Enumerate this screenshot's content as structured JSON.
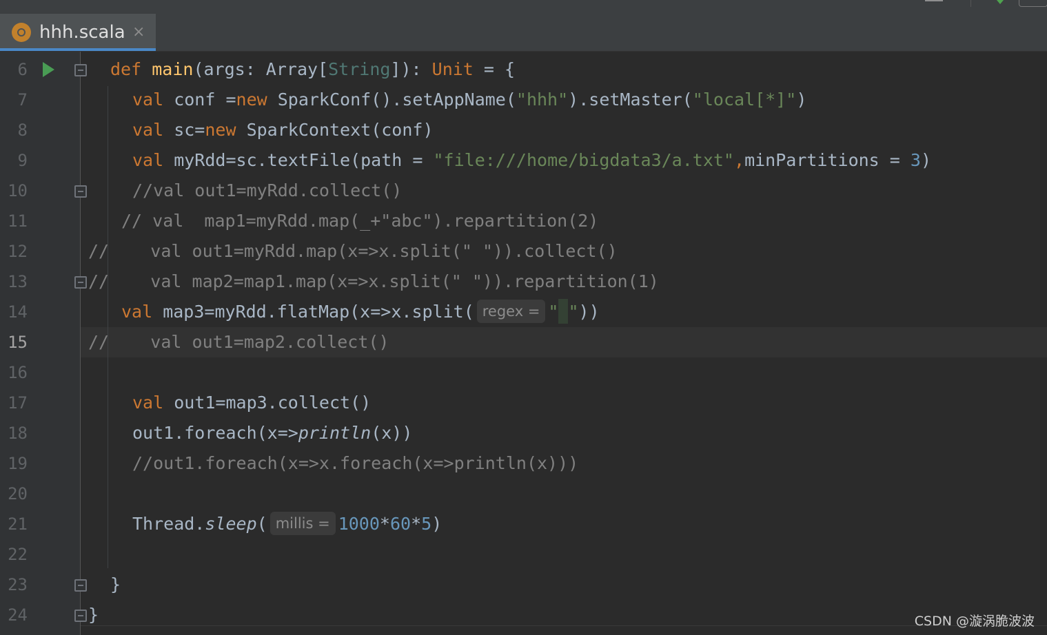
{
  "tab": {
    "label": "hhh.scala",
    "close": "×"
  },
  "gutter": {
    "line_numbers": [
      "6",
      "7",
      "8",
      "9",
      "10",
      "11",
      "12",
      "13",
      "14",
      "15",
      "16",
      "17",
      "18",
      "19",
      "20",
      "21",
      "22",
      "23",
      "24"
    ],
    "current_line": "15"
  },
  "code": {
    "l6": {
      "kw_def": "def",
      "fn": "main",
      "p1": "(args: Array[",
      "type": "String",
      "p2": "]): ",
      "kw_unit": "Unit",
      "p3": " = {"
    },
    "l7": {
      "kw": "val",
      "p1": " conf =",
      "kw_new": "new",
      "p2": " SparkConf().setAppName(",
      "s1": "\"hhh\"",
      "p3": ").setMaster(",
      "s2": "\"local[*]\"",
      "p4": ")"
    },
    "l8": {
      "kw": "val",
      "p1": " sc=",
      "kw_new": "new",
      "p2": " SparkContext(conf)"
    },
    "l9": {
      "kw": "val",
      "p1": " myRdd=sc.textFile(path = ",
      "s1": "\"file:///home/bigdata3/a.txt\"",
      "comma": ",",
      "p2": "minPartitions = ",
      "n1": "3",
      "p3": ")"
    },
    "l10": {
      "comment": "//val out1=myRdd.collect()"
    },
    "l11": {
      "comment": "// val  map1=myRdd.map(_+\"abc\").repartition(2)"
    },
    "l12": {
      "comment": "//    val out1=myRdd.map(x=>x.split(\" \")).collect()"
    },
    "l13": {
      "comment": "//    val map2=map1.map(x=>x.split(\" \")).repartition(1)"
    },
    "l14": {
      "kw": "val",
      "p1": " map3=myRdd.flatMap(x=>x.split(",
      "hint": "regex =",
      "s1": "\"",
      "s2": "\"",
      "p2": "))"
    },
    "l15": {
      "comment": "//    val out1=map2.collect()"
    },
    "l17": {
      "kw": "val",
      "p1": " out1=map3.collect()"
    },
    "l18": {
      "p1": "out1.foreach(x=>",
      "fn": "println",
      "p2": "(x))"
    },
    "l19": {
      "comment": "//out1.foreach(x=>x.foreach(x=>println(x)))"
    },
    "l21": {
      "p1": "Thread.",
      "fn": "sleep",
      "p2": "(",
      "hint": "millis =",
      "n1": "1000",
      "op1": "*",
      "n2": "60",
      "op2": "*",
      "n3": "5",
      "p3": ")"
    },
    "l23": {
      "p1": "}"
    },
    "l24": {
      "p1": "}"
    }
  },
  "watermark": "CSDN @漩涡脆波波"
}
